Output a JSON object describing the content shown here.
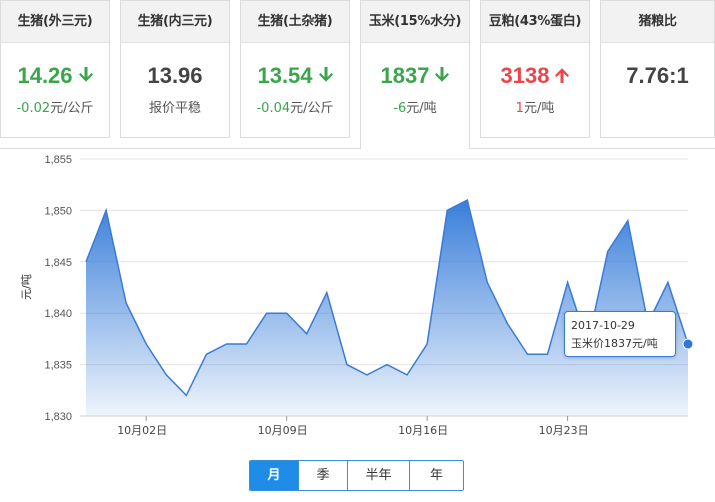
{
  "cards": [
    {
      "title": "生猪(外三元)",
      "value": "14.26",
      "direction": "down",
      "change": "-0.02",
      "unit": "元/公斤",
      "active": false
    },
    {
      "title": "生猪(内三元)",
      "value": "13.96",
      "direction": "none",
      "change": "",
      "unit": "报价平稳",
      "active": false
    },
    {
      "title": "生猪(土杂猪)",
      "value": "13.54",
      "direction": "down",
      "change": "-0.04",
      "unit": "元/公斤",
      "active": false
    },
    {
      "title": "玉米(15%水分)",
      "value": "1837",
      "direction": "down",
      "change": "-6",
      "unit": "元/吨",
      "active": true
    },
    {
      "title": "豆粕(43%蛋白)",
      "value": "3138",
      "direction": "up",
      "change": "1",
      "unit": "元/吨",
      "active": false
    },
    {
      "title": "猪粮比",
      "value": "7.76:1",
      "direction": "none",
      "change": "",
      "unit": "",
      "active": false
    }
  ],
  "colors": {
    "down": "#3aa54a",
    "up": "#e9454a",
    "accent": "#1f8de8",
    "line": "#3a7bd5"
  },
  "tooltip": {
    "date": "2017-10-29",
    "text": "玉米价1837元/吨"
  },
  "periods": [
    "月",
    "季",
    "半年",
    "年"
  ],
  "active_period": "月",
  "chart_data": {
    "type": "area",
    "ylabel": "元/吨",
    "ylim": [
      1830,
      1855
    ],
    "yticks": [
      "1,830",
      "1,835",
      "1,840",
      "1,845",
      "1,850",
      "1,855"
    ],
    "ytick_values": [
      1830,
      1835,
      1840,
      1845,
      1850,
      1855
    ],
    "xticks": [
      "10月02日",
      "10月09日",
      "10月16日",
      "10月23日"
    ],
    "xtick_indices": [
      3,
      10,
      17,
      24
    ],
    "grid": true,
    "x": [
      "09-29",
      "09-30",
      "10-01",
      "10-02",
      "10-03",
      "10-04",
      "10-05",
      "10-06",
      "10-07",
      "10-08",
      "10-09",
      "10-10",
      "10-11",
      "10-12",
      "10-13",
      "10-14",
      "10-15",
      "10-16",
      "10-17",
      "10-18",
      "10-19",
      "10-20",
      "10-21",
      "10-22",
      "10-23",
      "10-24",
      "10-25",
      "10-26",
      "10-27",
      "10-28",
      "10-29"
    ],
    "values": [
      1845,
      1850,
      1841,
      1837,
      1834,
      1832,
      1836,
      1837,
      1837,
      1840,
      1840,
      1838,
      1842,
      1835,
      1834,
      1835,
      1834,
      1837,
      1850,
      1851,
      1843,
      1839,
      1836,
      1836,
      1843,
      1837,
      1846,
      1849,
      1839,
      1843,
      1837
    ]
  }
}
